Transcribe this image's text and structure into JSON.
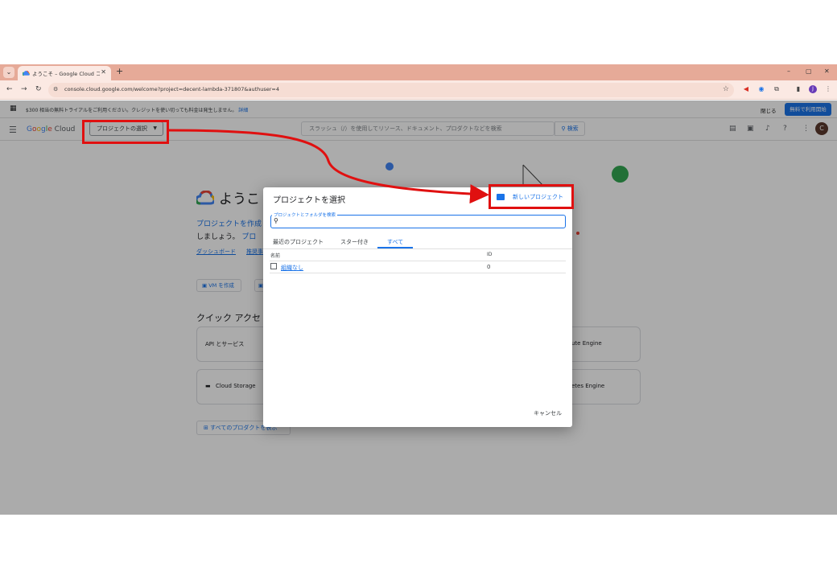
{
  "browser": {
    "tab_title": "ようこそ – Google Cloud コンソール",
    "tab_close": "✕",
    "new_tab": "+",
    "url": "console.cloud.google.com/welcome?project=decent-lambda-371807&authuser=4",
    "window_controls": [
      "–",
      "▢",
      "✕"
    ]
  },
  "promo": {
    "text": "$300 相当の無料トライアルをご利用ください。クレジットを使い切っても料金は発生しません。",
    "link": "詳細",
    "dismiss": "閉じる",
    "cta": "無料で利用開始"
  },
  "header": {
    "logo_google": [
      "G",
      "o",
      "o",
      "g",
      "l",
      "e"
    ],
    "logo_cloud": "Cloud",
    "project_picker": "プロジェクトの選択",
    "search_placeholder": "スラッシュ（/）を使用してリソース、ドキュメント、プロダクトなどを検索",
    "search_button": "検索",
    "avatar": "C"
  },
  "welcome": {
    "title": "ようこ",
    "text1": "プロジェクトを作成",
    "text2": "しましょう。",
    "text2_link": "プロ",
    "link_dashboard": "ダッシュボード",
    "link_recommend": "推奨事",
    "vm_button": "VM を作成",
    "quick_access": "クイック アクセ",
    "cards": {
      "api": "API とサービス",
      "compute": "ute Engine",
      "storage": "Cloud Storage",
      "kubernetes": "etes Engine"
    },
    "all_products": "すべてのプロダクトを表示"
  },
  "dialog": {
    "title": "プロジェクトを選択",
    "new_project": "新しいプロジェクト",
    "search_label": "プロジェクトとフォルダを検索",
    "tabs": [
      "最近のプロジェクト",
      "スター付き",
      "すべて"
    ],
    "active_tab": "すべて",
    "columns": [
      "名前",
      "ID"
    ],
    "rows": [
      {
        "name": "組織なし",
        "id": "0"
      }
    ],
    "cancel": "キャンセル"
  },
  "colors": {
    "accent": "#1a73e8",
    "annotation": "#e01010",
    "tabstrip": "#e6aa98"
  }
}
